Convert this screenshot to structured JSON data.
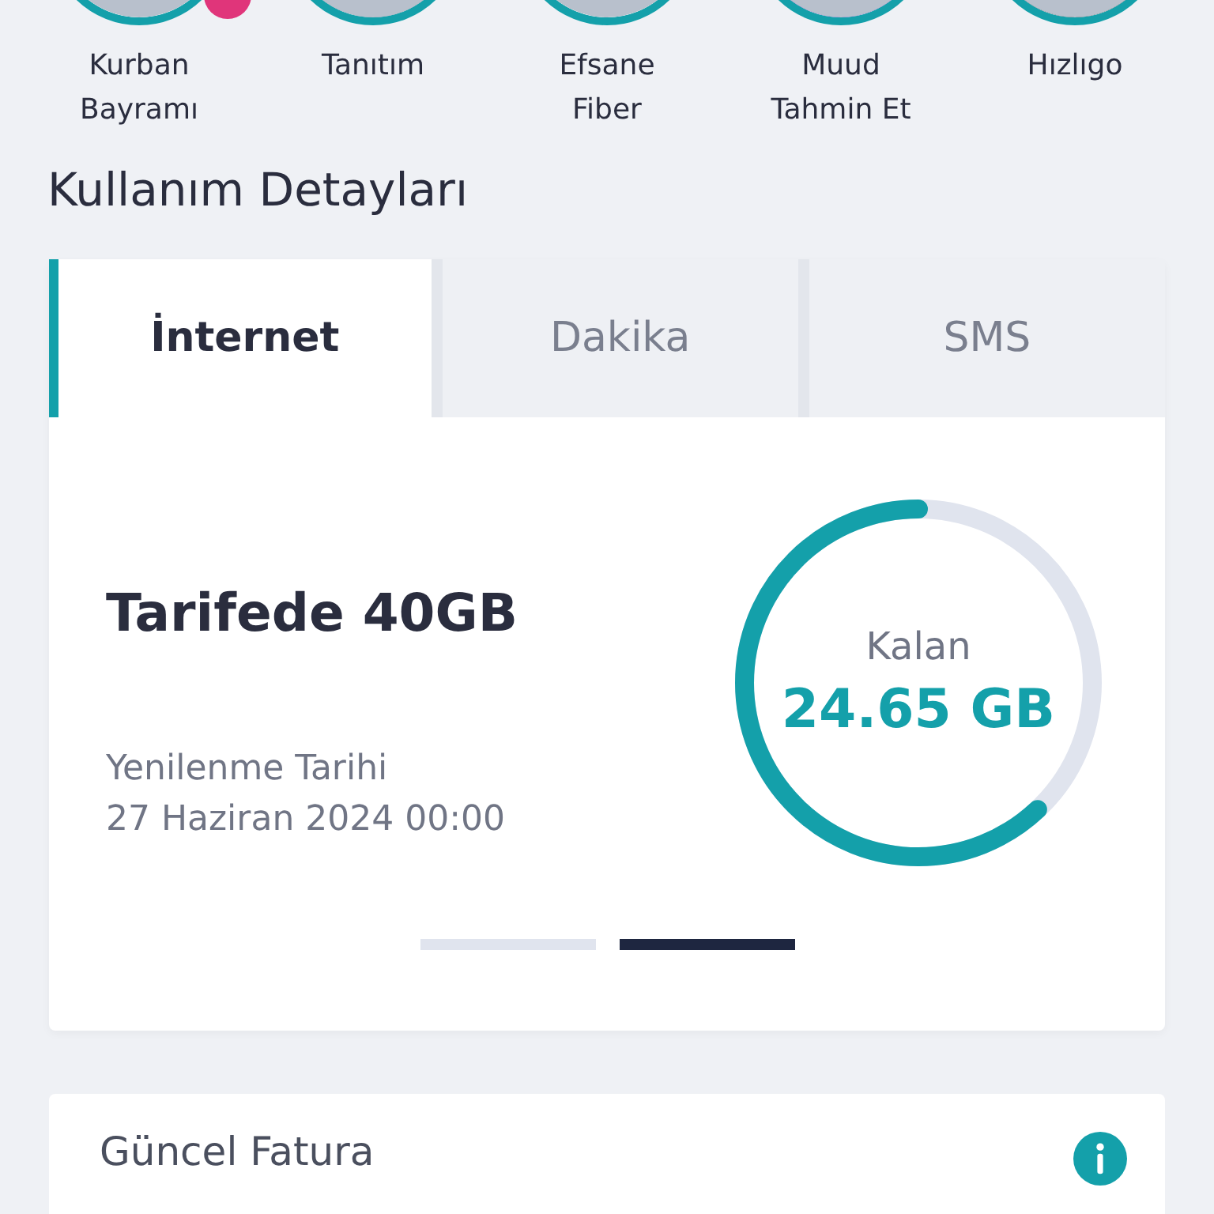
{
  "stories": [
    {
      "label": "Kurban Bayramı",
      "badge": true
    },
    {
      "label": "Tanıtım",
      "badge": false
    },
    {
      "label": "Efsane Fiber",
      "badge": false
    },
    {
      "label": "Muud Tahmin Et",
      "badge": false
    },
    {
      "label": "Hızlıgo",
      "badge": false
    }
  ],
  "section_title": "Kullanım Detayları",
  "tabs": [
    {
      "label": "İnternet",
      "selected": true
    },
    {
      "label": "Dakika",
      "selected": false
    },
    {
      "label": "SMS",
      "selected": false
    }
  ],
  "usage": {
    "plan": "Tarifede 40GB",
    "renewal_label": "Yenilenme Tarihi",
    "renewal_date": "27 Haziran 2024 00:00",
    "remaining_label": "Kalan",
    "remaining": "24.65 GB",
    "level": 0.62
  },
  "pager": [
    {
      "selected": false
    },
    {
      "selected": true
    }
  ],
  "bill_card": {
    "title": "Güncel Fatura"
  }
}
